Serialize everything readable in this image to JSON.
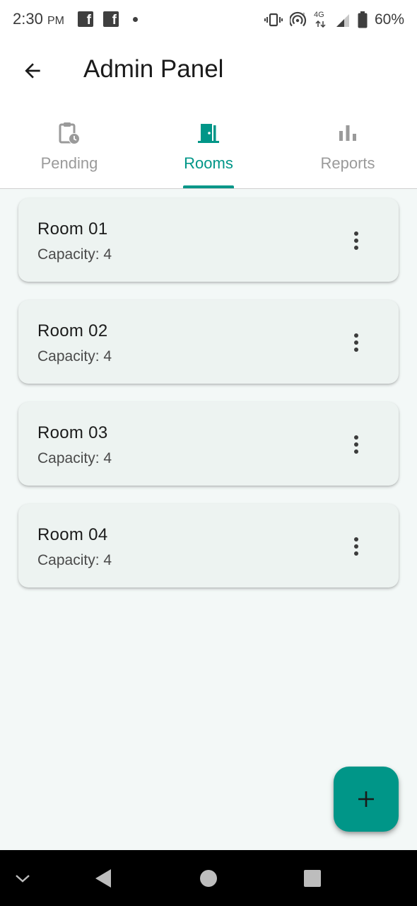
{
  "status_bar": {
    "time": "2:30",
    "ampm": "PM",
    "notification_icons": [
      "facebook-icon",
      "facebook-icon",
      "dot-icon"
    ],
    "network": "4G",
    "battery_percent": "60%"
  },
  "app_bar": {
    "title": "Admin Panel",
    "back_icon": "arrow-back-icon"
  },
  "tabs": [
    {
      "label": "Pending",
      "icon": "pending-clipboard-icon",
      "active": false
    },
    {
      "label": "Rooms",
      "icon": "door-icon",
      "active": true
    },
    {
      "label": "Reports",
      "icon": "bar-chart-icon",
      "active": false
    }
  ],
  "rooms": [
    {
      "name": "Room 01",
      "capacity": "Capacity: 4"
    },
    {
      "name": "Room 02",
      "capacity": "Capacity: 4"
    },
    {
      "name": "Room 03",
      "capacity": "Capacity: 4"
    },
    {
      "name": "Room 04",
      "capacity": "Capacity: 4"
    }
  ],
  "fab": {
    "icon": "add-icon"
  },
  "colors": {
    "accent": "#009688",
    "background": "#f3f8f7",
    "card": "#edf3f1",
    "inactive_tab": "#9a9a9a"
  }
}
